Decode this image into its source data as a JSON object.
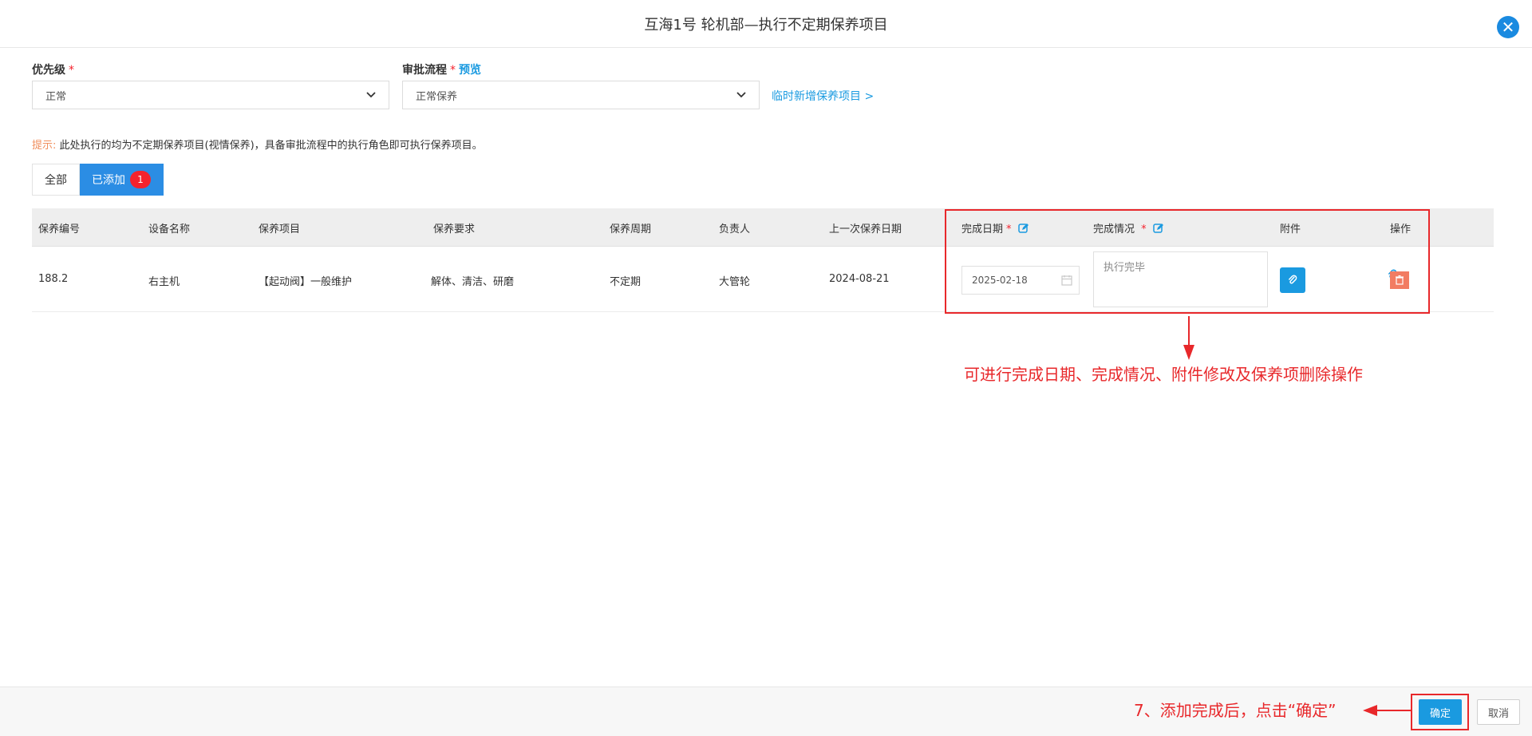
{
  "dialog": {
    "title": "互海1号 轮机部—执行不定期保养项目",
    "close_icon": "close-icon"
  },
  "form": {
    "priority": {
      "label": "优先级",
      "required_mark": "*",
      "value": "正常"
    },
    "approval": {
      "label": "审批流程",
      "required_mark": "*",
      "preview_label": "预览",
      "value": "正常保养"
    },
    "add_temp_link": "临时新增保养项目 >"
  },
  "tip": {
    "label": "提示:",
    "text": "此处执行的均为不定期保养项目(视情保养)，具备审批流程中的执行角色即可执行保养项目。"
  },
  "tabs": {
    "all_label": "全部",
    "added_label": "已添加",
    "added_count": "1"
  },
  "table": {
    "headers": {
      "code": "保养编号",
      "device": "设备名称",
      "item": "保养项目",
      "requirement": "保养要求",
      "cycle": "保养周期",
      "owner": "负责人",
      "last_date": "上一次保养日期",
      "finish_date": "完成日期",
      "finish_status": "完成情况",
      "attachment": "附件",
      "action": "操作",
      "required_mark": "*"
    },
    "rows": [
      {
        "code": "188.2",
        "device": "右主机",
        "item": "【起动阀】一般维护",
        "requirement": "解体、清洁、研磨",
        "cycle": "不定期",
        "owner": "大管轮",
        "last_date": "2024-08-21",
        "finish_date": "2025-02-18",
        "finish_status_placeholder": "执行完毕"
      }
    ]
  },
  "annotations": {
    "table_note": "可进行完成日期、完成情况、附件修改及保养项删除操作",
    "footer_note": "7、添加完成后，点击“确定”"
  },
  "footer": {
    "confirm_label": "确定",
    "cancel_label": "取消"
  },
  "colors": {
    "accent": "#1a9ae0",
    "annotation_red": "#e8282b",
    "badge_red": "#f5222d",
    "delete_orange": "#f27c62"
  }
}
